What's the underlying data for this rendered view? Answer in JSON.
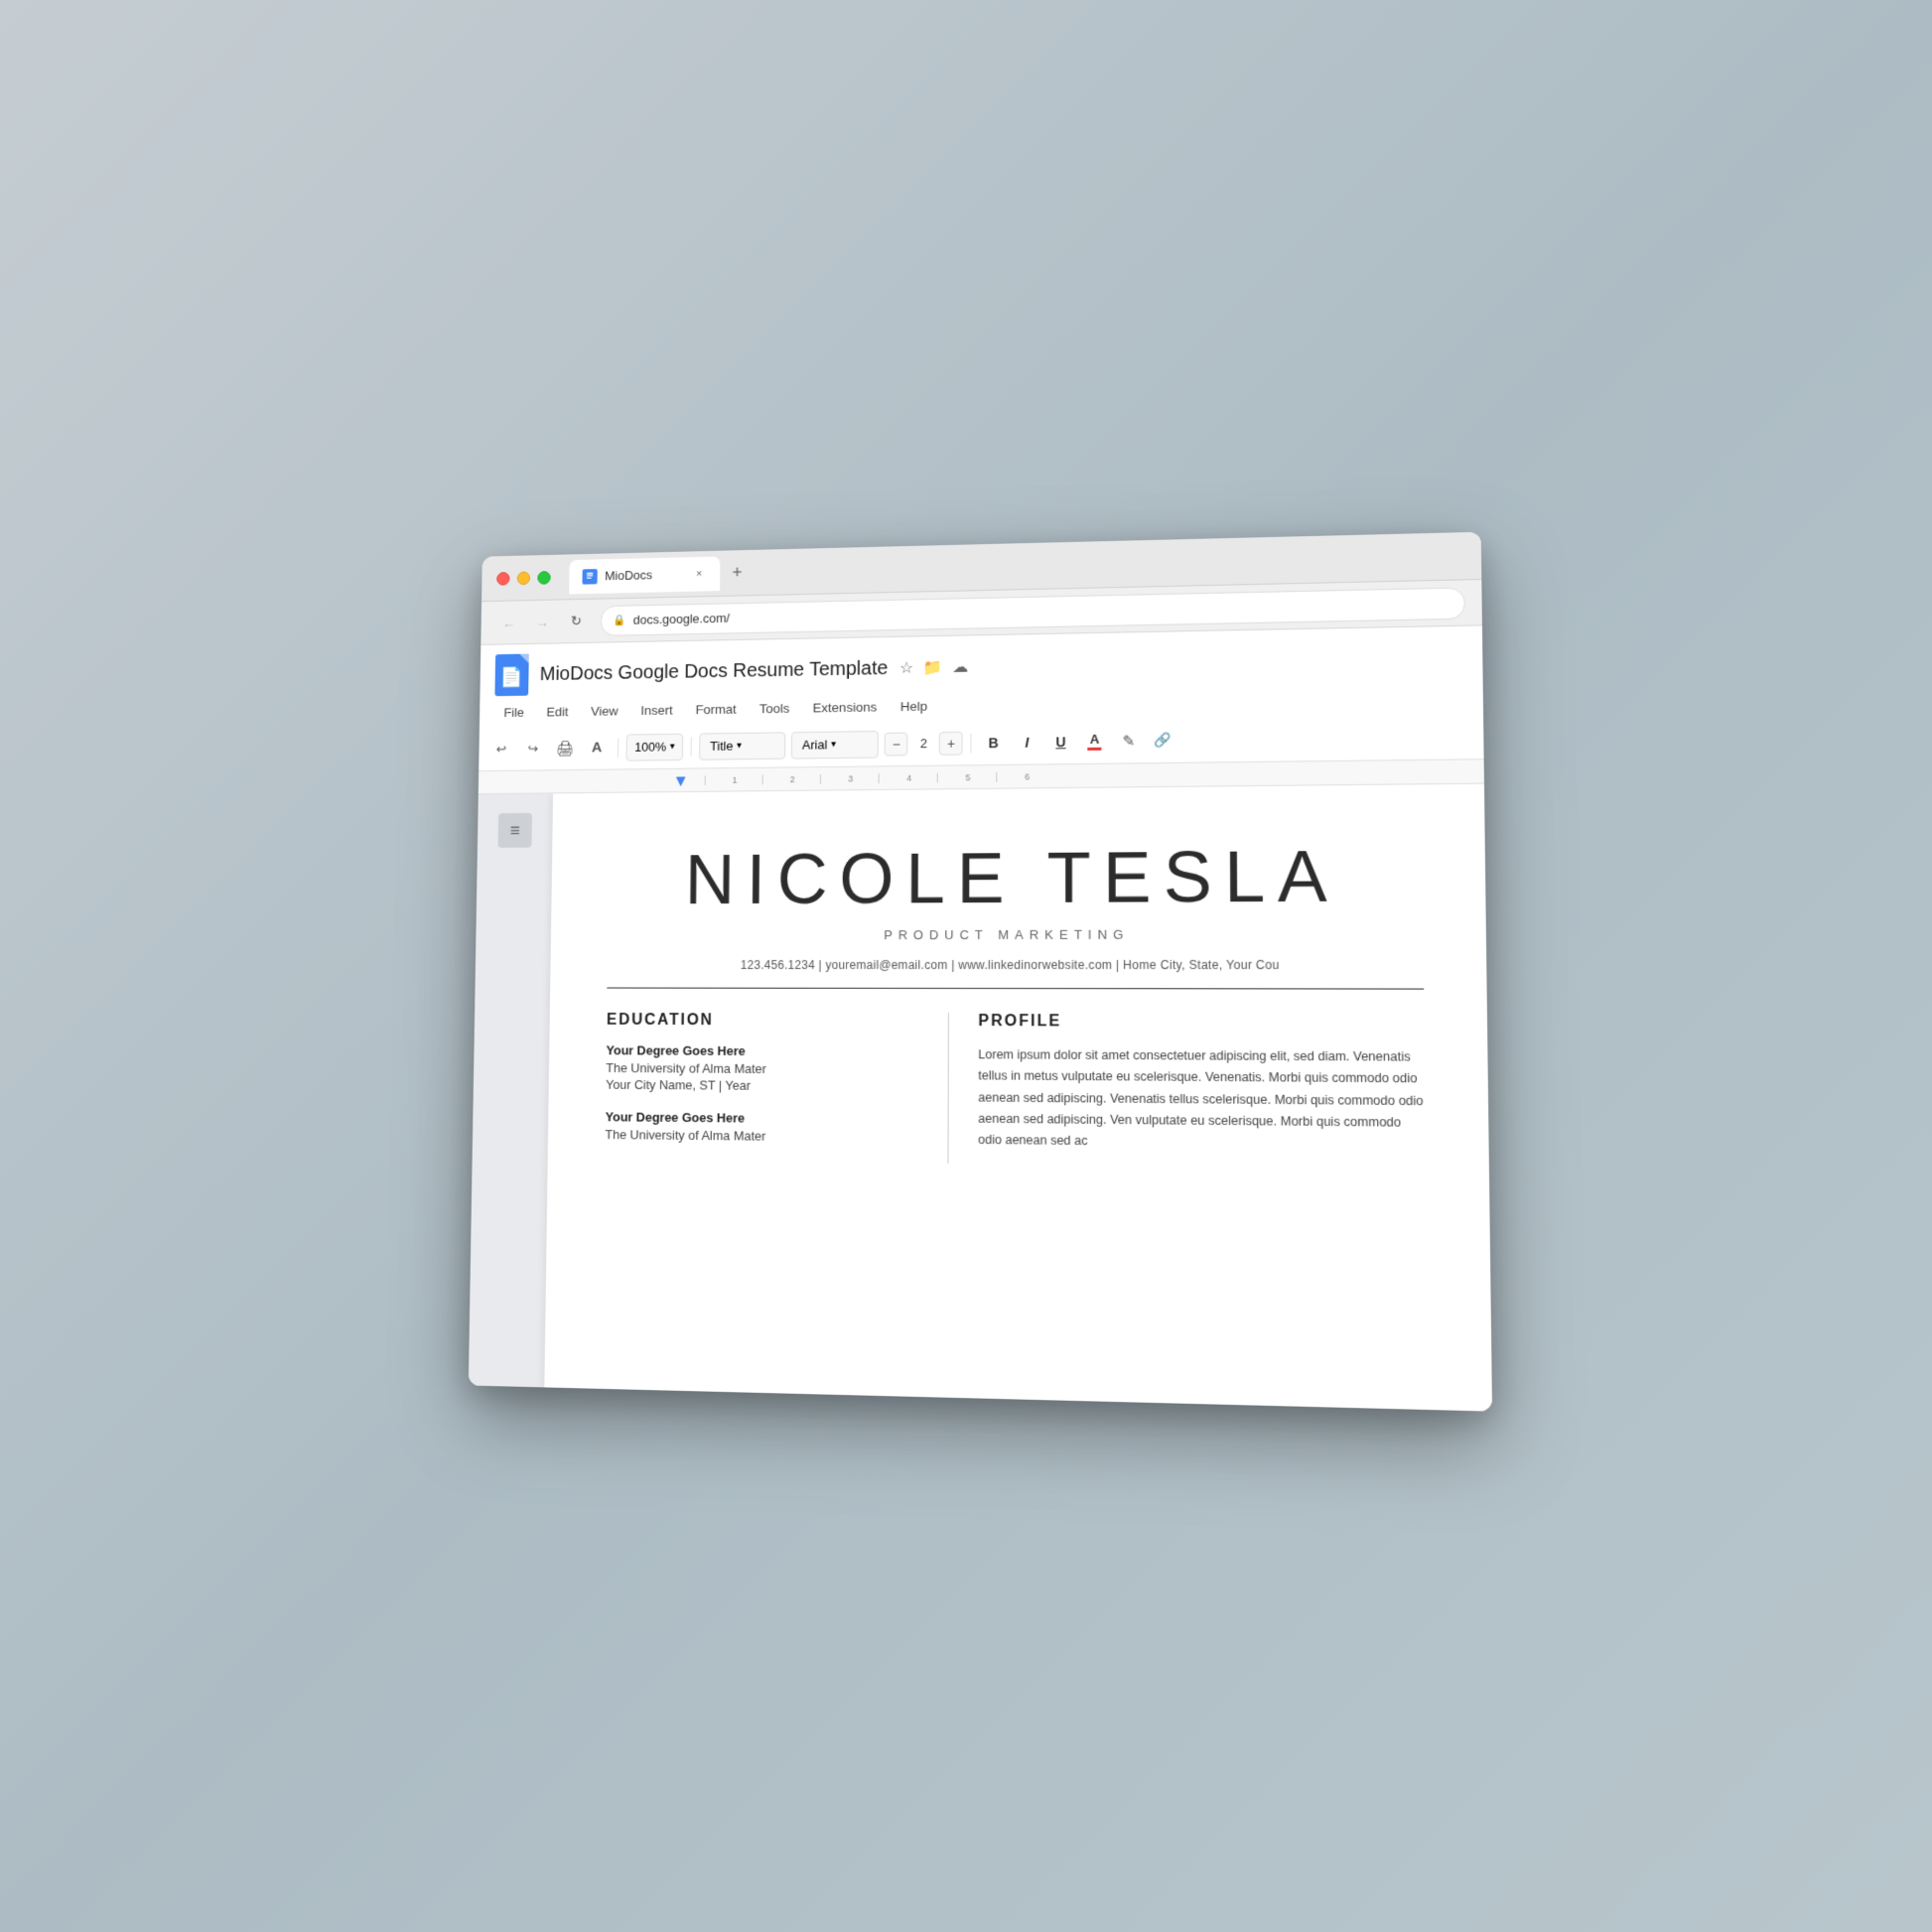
{
  "browser": {
    "traffic_lights": {
      "close": "close",
      "minimize": "minimize",
      "maximize": "maximize"
    },
    "tab": {
      "title": "MioDocs",
      "close_label": "×"
    },
    "new_tab_label": "+",
    "address": "docs.google.com/"
  },
  "docs": {
    "doc_title": "MioDocs Google Docs Resume Template",
    "logo_alt": "Google Docs logo",
    "menu_items": [
      "File",
      "Edit",
      "View",
      "Insert",
      "Format",
      "Tools",
      "Extensions",
      "Help"
    ],
    "toolbar": {
      "undo_label": "↩",
      "redo_label": "↪",
      "print_label": "🖨",
      "paint_format_label": "A",
      "zoom_value": "100%",
      "zoom_chevron": "▾",
      "style_value": "Title",
      "style_chevron": "▾",
      "font_value": "Arial",
      "font_chevron": "▾",
      "font_size_minus": "−",
      "font_size_value": "2",
      "font_size_plus": "+",
      "bold_label": "B",
      "italic_label": "I",
      "underline_label": "U",
      "text_color_label": "A",
      "highlight_label": "✎",
      "link_label": "🔗"
    }
  },
  "resume": {
    "name": "NICOLE TESLA",
    "job_title": "PRODUCT MARKETING",
    "contact": "123.456.1234  |  youremail@email.com  |  www.linkedinorwebsite.com  |  Home City, State, Your Cou",
    "sections": {
      "left": {
        "heading": "EDUCATION",
        "items": [
          {
            "degree": "Your Degree Goes Here",
            "school": "The University of Alma Mater",
            "detail": "Your City Name, ST | Year"
          },
          {
            "degree": "Your Degree Goes Here",
            "school": "The University of Alma Mater",
            "detail": ""
          }
        ]
      },
      "right": {
        "heading": "PROFILE",
        "text": "Lorem ipsum dolor sit amet consectetuer adipiscing elit, sed diam. Venenatis tellus in metus vulputate eu scelerisque. Venenatis. Morbi quis commodo odio aenean sed adipiscing. Venenatis tellus scelerisque. Morbi quis commodo odio aenean sed adipiscing. Ven vulputate eu scelerisque. Morbi quis commodo odio aenean sed ac"
      }
    }
  },
  "sidebar": {
    "outline_icon": "≡"
  }
}
